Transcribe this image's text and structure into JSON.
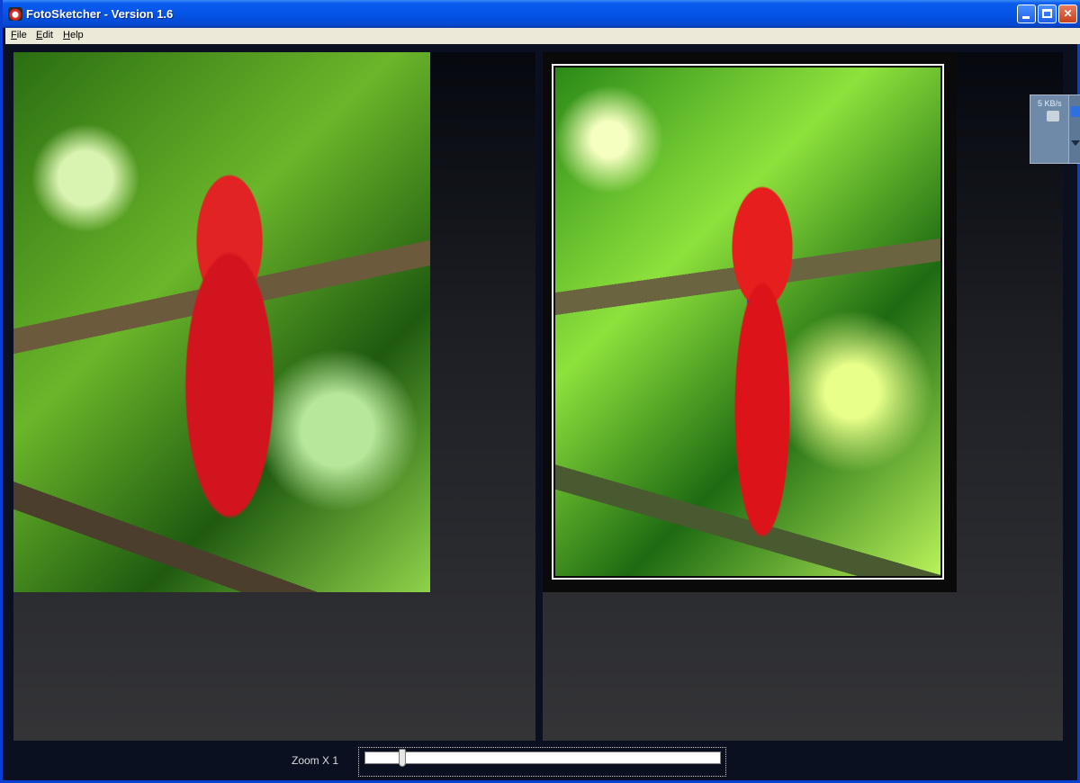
{
  "window": {
    "title": "FotoSketcher - Version 1.6"
  },
  "menu": {
    "items": [
      "File",
      "Edit",
      "Help"
    ]
  },
  "netmeter": {
    "rate": "5 KB/s"
  },
  "zoom": {
    "label": "Zoom X 1",
    "level": 0.1
  }
}
